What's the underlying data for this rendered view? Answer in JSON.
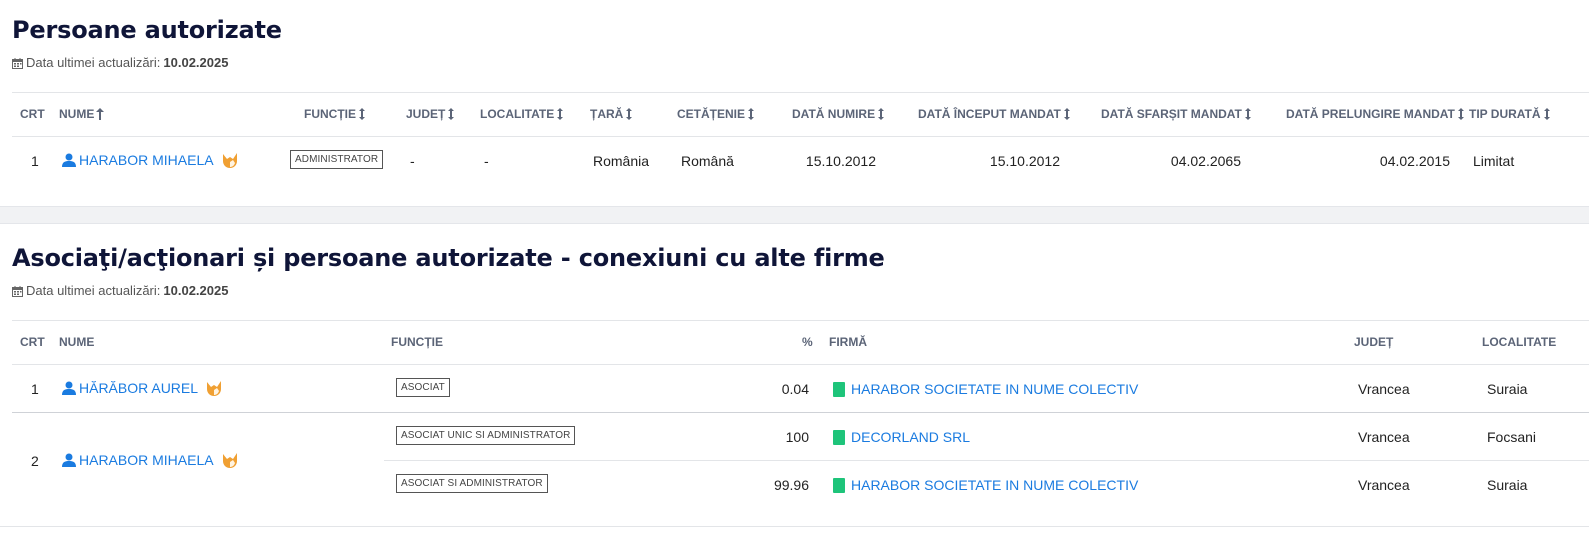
{
  "section1": {
    "title": "Persoane autorizate",
    "updated_label": "Data ultimei actualizări:",
    "updated_date": "10.02.2025",
    "headers": {
      "crt": "CRT",
      "nume": "NUME",
      "functie": "FUNCȚIE",
      "judet": "JUDEȚ",
      "localitate": "LOCALITATE",
      "tara": "ȚARĂ",
      "cetatenie": "CETĂȚENIE",
      "data_numire": "DATĂ NUMIRE",
      "data_inceput": "DATĂ ÎNCEPUT MANDAT",
      "data_sfarsit": "DATĂ SFARȘIT MANDAT",
      "data_prelungire": "DATĂ PRELUNGIRE MANDAT",
      "tip_durata": "TIP DURATĂ"
    },
    "rows": [
      {
        "crt": "1",
        "nume": "HARABOR MIHAELA",
        "functie": "ADMINISTRATOR",
        "judet": "-",
        "localitate": "-",
        "tara": "România",
        "cetatenie": "Română",
        "data_numire": "15.10.2012",
        "data_inceput": "15.10.2012",
        "data_sfarsit": "04.02.2065",
        "data_prelungire": "04.02.2015",
        "tip_durata": "Limitat"
      }
    ]
  },
  "section2": {
    "title": "Asociaţi/acţionari și persoane autorizate - conexiuni cu alte firme",
    "updated_label": "Data ultimei actualizări:",
    "updated_date": "10.02.2025",
    "headers": {
      "crt": "CRT",
      "nume": "NUME",
      "functie": "FUNCȚIE",
      "procent": "%",
      "firma": "FIRMĂ",
      "judet": "JUDEȚ",
      "localitate": "LOCALITATE"
    },
    "rows": [
      {
        "crt": "1",
        "nume": "HĂRĂBOR AUREL",
        "entries": [
          {
            "functie": "ASOCIAT",
            "procent": "0.04",
            "firma": "HARABOR SOCIETATE IN NUME COLECTIV",
            "judet": "Vrancea",
            "localitate": "Suraia"
          }
        ]
      },
      {
        "crt": "2",
        "nume": "HARABOR MIHAELA",
        "entries": [
          {
            "functie": "ASOCIAT UNIC SI ADMINISTRATOR",
            "procent": "100",
            "firma": "DECORLAND SRL",
            "judet": "Vrancea",
            "localitate": "Focsani"
          },
          {
            "functie": "ASOCIAT SI ADMINISTRATOR",
            "procent": "99.96",
            "firma": "HARABOR SOCIETATE IN NUME COLECTIV",
            "judet": "Vrancea",
            "localitate": "Suraia"
          }
        ]
      }
    ]
  },
  "colors": {
    "title": "#0f1538",
    "link": "#1a7be0",
    "header": "#5b6477",
    "fox": "#f0a033",
    "book": "#1ec47a"
  }
}
